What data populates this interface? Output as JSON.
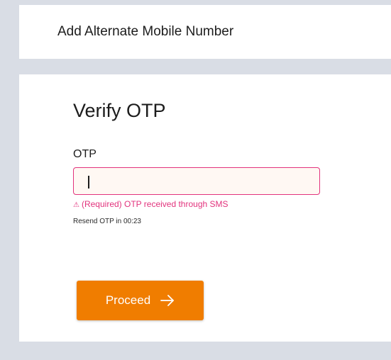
{
  "header": {
    "title": "Add Alternate Mobile Number"
  },
  "form": {
    "title": "Verify OTP",
    "otp_label": "OTP",
    "otp_value": "",
    "error_icon": "⚠",
    "error_text": "(Required) OTP received through SMS",
    "resend_text": "Resend OTP in 00:23",
    "proceed_label": "Proceed"
  },
  "colors": {
    "accent": "#f07d00",
    "error": "#e2337d",
    "input_background": "#fff8f3",
    "page_background": "#d9dde5"
  },
  "icons": {
    "error": "warning-icon",
    "proceed": "arrow-right-icon"
  }
}
